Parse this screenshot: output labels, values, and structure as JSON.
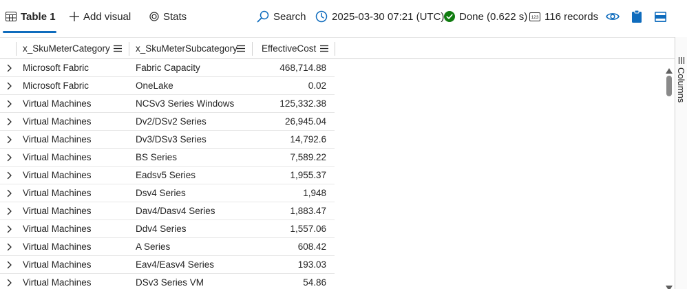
{
  "toolbar": {
    "tab_label": "Table 1",
    "add_visual_label": "Add visual",
    "stats_label": "Stats",
    "search_label": "Search",
    "timestamp": "2025-03-30 07:21 (UTC)",
    "status": "Done (0.622 s)",
    "records": "116 records"
  },
  "colors": {
    "accent": "#0f6cbd",
    "success": "#107c10"
  },
  "table": {
    "columns": [
      "x_SkuMeterCategory",
      "x_SkuMeterSubcategory",
      "EffectiveCost"
    ],
    "rows": [
      [
        "Microsoft Fabric",
        "Fabric Capacity",
        "468,714.88"
      ],
      [
        "Microsoft Fabric",
        "OneLake",
        "0.02"
      ],
      [
        "Virtual Machines",
        "NCSv3 Series Windows",
        "125,332.38"
      ],
      [
        "Virtual Machines",
        "Dv2/DSv2 Series",
        "26,945.04"
      ],
      [
        "Virtual Machines",
        "Dv3/DSv3 Series",
        "14,792.6"
      ],
      [
        "Virtual Machines",
        "BS Series",
        "7,589.22"
      ],
      [
        "Virtual Machines",
        "Eadsv5 Series",
        "1,955.37"
      ],
      [
        "Virtual Machines",
        "Dsv4 Series",
        "1,948"
      ],
      [
        "Virtual Machines",
        "Dav4/Dasv4 Series",
        "1,883.47"
      ],
      [
        "Virtual Machines",
        "Ddv4 Series",
        "1,557.06"
      ],
      [
        "Virtual Machines",
        "A Series",
        "608.42"
      ],
      [
        "Virtual Machines",
        "Eav4/Easv4 Series",
        "193.03"
      ],
      [
        "Virtual Machines",
        "DSv3 Series VM",
        "54.86"
      ]
    ]
  },
  "side_panel": {
    "label": "Columns"
  }
}
